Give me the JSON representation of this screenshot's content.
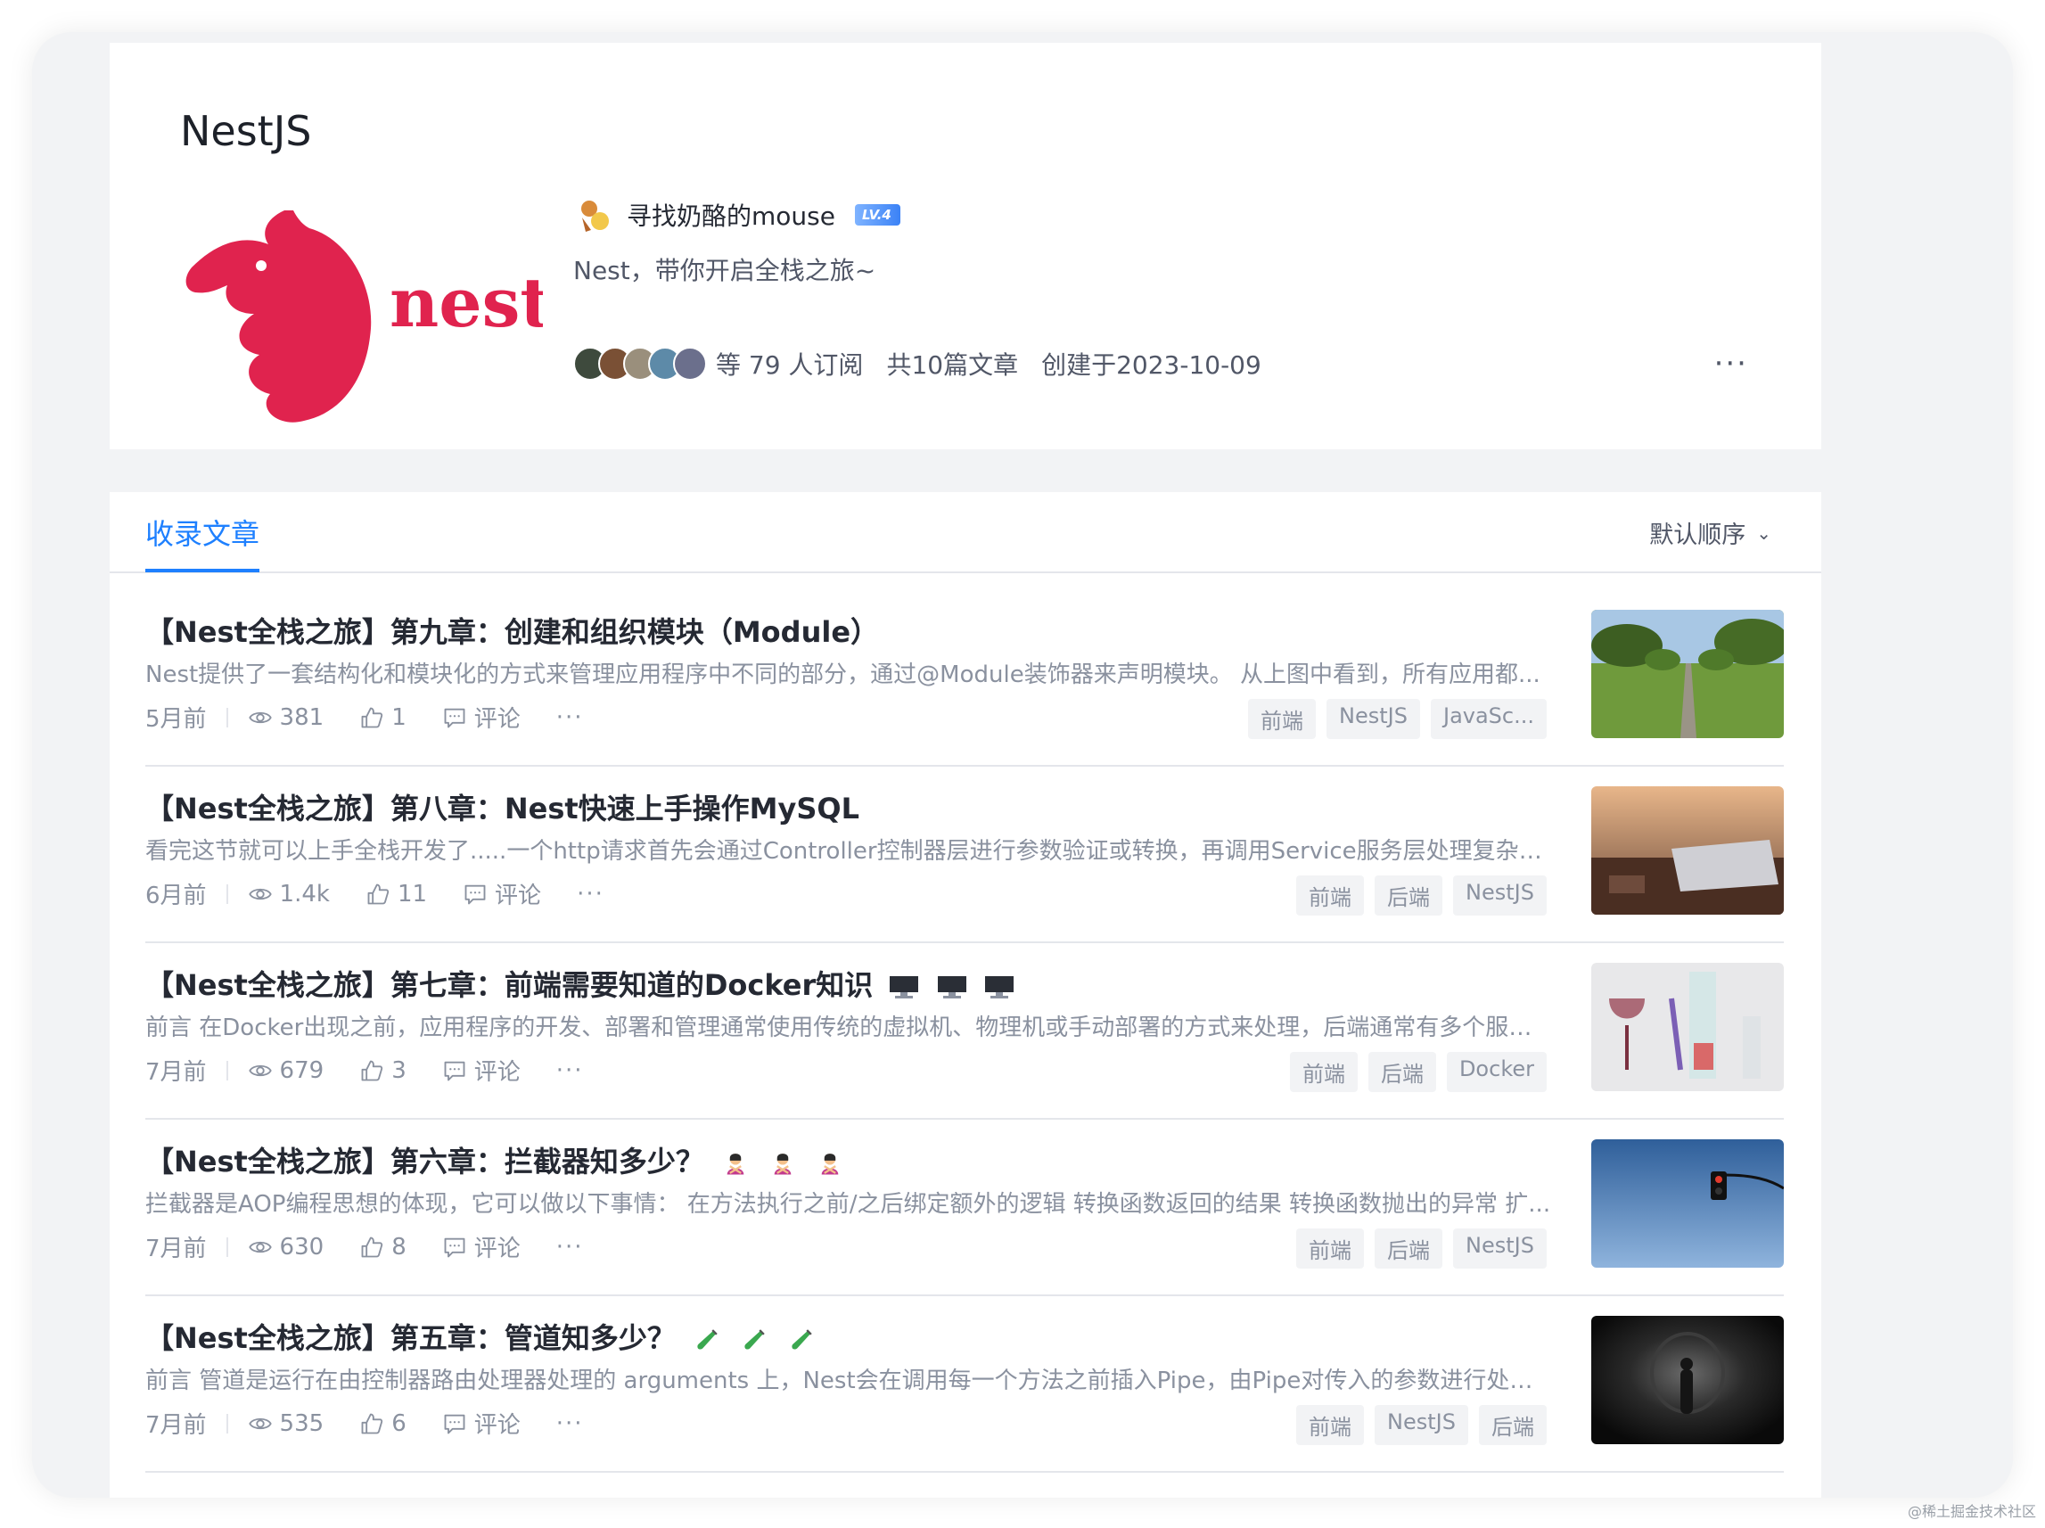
{
  "column": {
    "title": "NestJS",
    "cover_text": "nest",
    "author": "寻找奶酪的mouse",
    "level": "LV.4",
    "description": "Nest，带你开启全栈之旅~",
    "subscribers": "等 79 人订阅",
    "article_count": "共10篇文章",
    "created": "创建于2023-10-09",
    "more": "···"
  },
  "tabs": {
    "active": "收录文章",
    "sort": "默认顺序"
  },
  "articles": [
    {
      "title": "【Nest全栈之旅】第九章：创建和组织模块（Module）",
      "summary": "Nest提供了一套结构化和模块化的方式来管理应用程序中不同的部分，通过@Module装饰器来声明模块。 从上图中看到，所有应用都...",
      "time": "5月前",
      "views": "381",
      "likes": "1",
      "comment": "评论",
      "tags": [
        "前端",
        "NestJS",
        "JavaSc..."
      ],
      "thumb_icon": "road-landscape"
    },
    {
      "title": "【Nest全栈之旅】第八章：Nest快速上手操作MySQL",
      "summary": "看完这节就可以上手全栈开发了.....一个http请求首先会通过Controller控制器层进行参数验证或转换，再调用Service服务层处理复杂的...",
      "time": "6月前",
      "views": "1.4k",
      "likes": "11",
      "comment": "评论",
      "tags": [
        "前端",
        "后端",
        "NestJS"
      ],
      "thumb_icon": "laptop-desk"
    },
    {
      "title": "【Nest全栈之旅】第七章：前端需要知道的Docker知识",
      "summary": "前言 在Docker出现之前，应用程序的开发、部署和管理通常使用传统的虚拟机、物理机或手动部署的方式来处理，后端通常有多个服务...",
      "time": "7月前",
      "views": "679",
      "likes": "3",
      "comment": "评论",
      "tags": [
        "前端",
        "后端",
        "Docker"
      ],
      "thumb_icon": "glass-vases"
    },
    {
      "title": "【Nest全栈之旅】第六章：拦截器知多少？",
      "summary": "拦截器是AOP编程思想的体现，它可以做以下事情： 在方法执行之前/之后绑定额外的逻辑 转换函数返回的结果 转换函数抛出的异常 扩...",
      "time": "7月前",
      "views": "630",
      "likes": "8",
      "comment": "评论",
      "tags": [
        "前端",
        "后端",
        "NestJS"
      ],
      "thumb_icon": "traffic-light"
    },
    {
      "title": "【Nest全栈之旅】第五章：管道知多少？",
      "summary": "前言 管道是运行在由控制器路由处理器处理的 arguments 上，Nest会在调用每一个方法之前插入Pipe，由Pipe对传入的参数进行处理...",
      "time": "7月前",
      "views": "535",
      "likes": "6",
      "comment": "评论",
      "tags": [
        "前端",
        "NestJS",
        "后端"
      ],
      "thumb_icon": "tunnel"
    }
  ],
  "watermark": "@稀土掘金技术社区"
}
